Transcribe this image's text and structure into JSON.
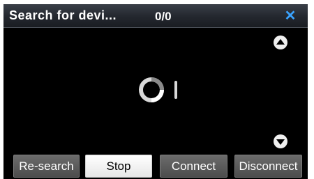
{
  "header": {
    "title": "Search for devi...",
    "counter": "0/0"
  },
  "icons": {
    "close": "close-icon",
    "scroll_up": "scroll-up-icon",
    "scroll_down": "scroll-down-icon",
    "spinner": "loading-spinner-icon"
  },
  "colors": {
    "accent": "#3aa3ff",
    "active_button_bg": "#ffffff",
    "button_bg": "#5a5a5a"
  },
  "buttons": [
    {
      "label": "Re-search",
      "active": false
    },
    {
      "label": "Stop",
      "active": true
    },
    {
      "label": "Connect",
      "active": false
    },
    {
      "label": "Disconnect",
      "active": false
    }
  ]
}
